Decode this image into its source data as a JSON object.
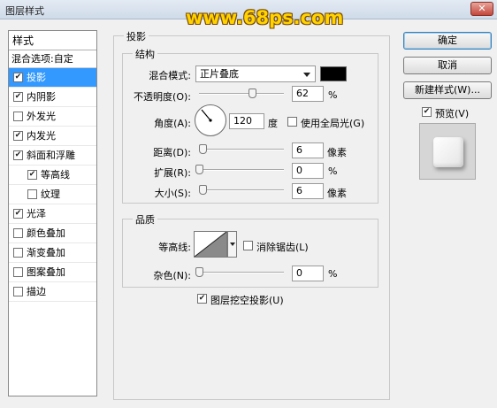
{
  "window": {
    "title": "图层样式",
    "close_glyph": "✕"
  },
  "watermark": "www.68ps.com",
  "left_panel": {
    "header": "样式",
    "blend_options": "混合选项:自定",
    "items": [
      {
        "label": "投影",
        "checked": true
      },
      {
        "label": "内阴影",
        "checked": true
      },
      {
        "label": "外发光",
        "checked": false
      },
      {
        "label": "内发光",
        "checked": true
      },
      {
        "label": "斜面和浮雕",
        "checked": true
      },
      {
        "label": "等高线",
        "checked": true
      },
      {
        "label": "纹理",
        "checked": false
      },
      {
        "label": "光泽",
        "checked": true
      },
      {
        "label": "颜色叠加",
        "checked": false
      },
      {
        "label": "渐变叠加",
        "checked": false
      },
      {
        "label": "图案叠加",
        "checked": false
      },
      {
        "label": "描边",
        "checked": false
      }
    ]
  },
  "drop_shadow": {
    "group_title": "投影",
    "structure": {
      "title": "结构",
      "blend_mode_label": "混合模式:",
      "blend_mode_value": "正片叠底",
      "color": "#000000",
      "opacity_label": "不透明度(O):",
      "opacity_value": "62",
      "opacity_unit": "%",
      "opacity_level": 0.62,
      "angle_label": "角度(A):",
      "angle_value": "120",
      "angle_unit": "度",
      "global_light_label": "使用全局光(G)",
      "global_light_checked": false,
      "distance_label": "距离(D):",
      "distance_value": "6",
      "distance_unit": "像素",
      "spread_label": "扩展(R):",
      "spread_value": "0",
      "spread_unit": "%",
      "size_label": "大小(S):",
      "size_value": "6",
      "size_unit": "像素"
    },
    "quality": {
      "title": "品质",
      "contour_label": "等高线:",
      "anti_alias_label": "消除锯齿(L)",
      "anti_alias_checked": false,
      "noise_label": "杂色(N):",
      "noise_value": "0",
      "noise_unit": "%"
    },
    "knockout_label": "图层挖空投影(U)",
    "knockout_checked": true
  },
  "buttons": {
    "ok": "确定",
    "cancel": "取消",
    "new_style": "新建样式(W)...",
    "preview_label": "预览(V)",
    "preview_checked": true
  }
}
